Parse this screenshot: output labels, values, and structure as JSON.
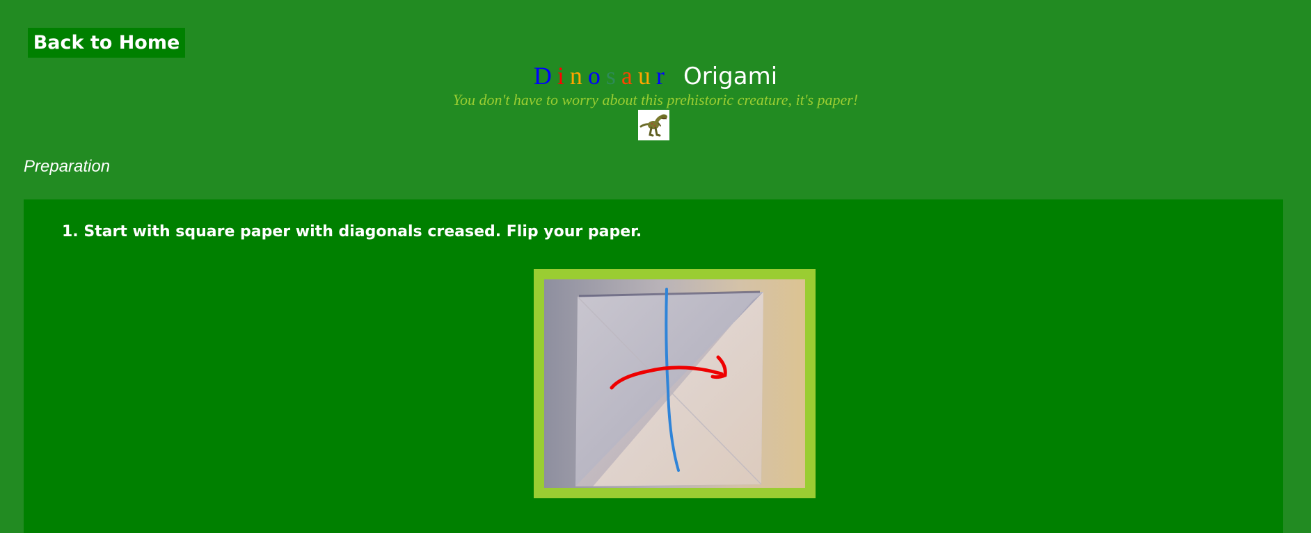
{
  "header": {
    "back_button_label": "Back to Home",
    "title_letters": [
      {
        "char": "D",
        "color": "#0000ff"
      },
      {
        "char": "i",
        "color": "#ff0000"
      },
      {
        "char": "n",
        "color": "#ffa500"
      },
      {
        "char": "o",
        "color": "#0000ff"
      },
      {
        "char": "s",
        "color": "#2e8b57"
      },
      {
        "char": "a",
        "color": "#ff4500"
      },
      {
        "char": "u",
        "color": "#ffa500"
      },
      {
        "char": "r",
        "color": "#0000ff"
      }
    ],
    "title_word_two": "Origami",
    "subtitle": "You don't have to worry about this prehistoric creature, it's paper!",
    "mascot_icon": "dinosaur-image"
  },
  "section": {
    "heading": "Preparation"
  },
  "steps": [
    {
      "text": "1. Start with square paper with diagonals creased. Flip your paper.",
      "image": "folded-paper-flip-diagram"
    }
  ],
  "colors": {
    "page_background": "#228b22",
    "panel_background": "#008000",
    "image_frame": "#9acd32",
    "subtitle": "#9acd32",
    "text": "#ffffff"
  }
}
